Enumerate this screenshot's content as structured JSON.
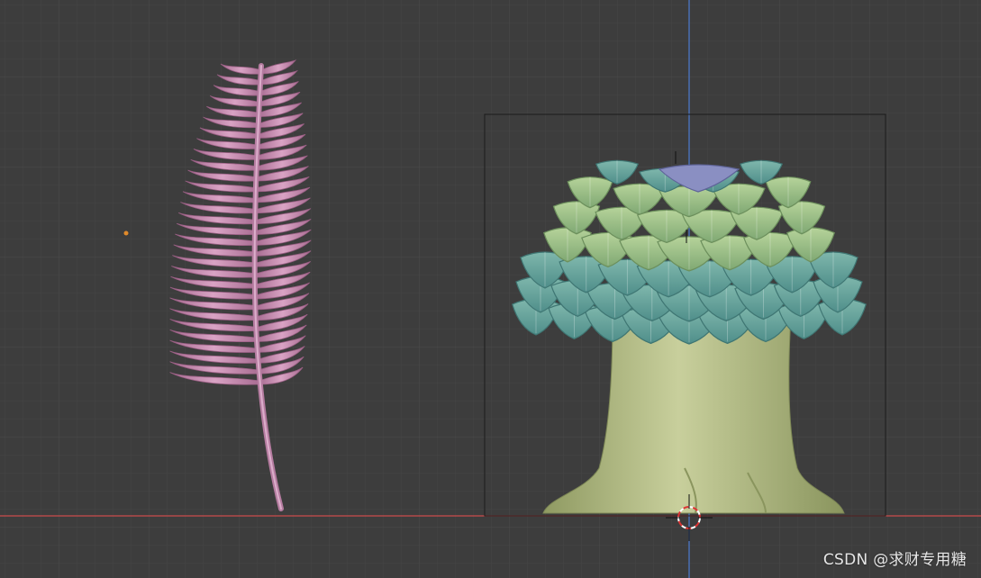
{
  "viewport": {
    "name": "3d-viewport",
    "background": "#3d3d3d",
    "grid_minor_color": "#454545",
    "grid_major_color": "#4a4a4a",
    "x_axis_color": "#b34a4a",
    "z_axis_color": "#4a6fb3"
  },
  "objects": {
    "fern": {
      "name": "fern-leaf",
      "color": "#c98fb2"
    },
    "tree": {
      "name": "tree-stump-with-leaves",
      "trunk_color": "#b7bf8a",
      "leaf_colors": [
        "#8dbf9f",
        "#a9c98e",
        "#6aa6a0"
      ],
      "top_leaf_color": "#8a8fc2"
    },
    "selection_bounds": {
      "name": "selection-bounding-box"
    },
    "origin_dot": {
      "color": "#e08a2a"
    }
  },
  "watermark": {
    "text": "CSDN @求财专用糖"
  }
}
